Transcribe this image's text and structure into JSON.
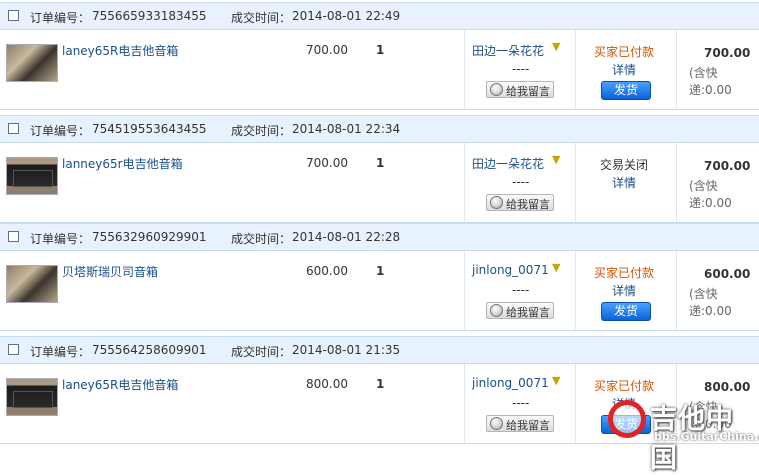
{
  "labels": {
    "order_no": "订单编号：",
    "deal_time": "成交时间：",
    "leave_message": "给我留言",
    "detail": "详情",
    "ship": "发货",
    "dashes": "----"
  },
  "orders": [
    {
      "order_no": "755665933183455",
      "deal_time": "2014-08-01 22:49",
      "product": "laney65R电吉他音箱",
      "price": "700.00",
      "qty": "1",
      "buyer": "田边一朵花花",
      "status": "买家已付款",
      "total": "700.00",
      "ship_fee": "(含快递:0.00"
    },
    {
      "order_no": "754519553643455",
      "deal_time": "2014-08-01 22:34",
      "product": "lanney65r电吉他音箱",
      "price": "700.00",
      "qty": "1",
      "buyer": "田边一朵花花",
      "status": "交易关闭",
      "total": "700.00",
      "ship_fee": "(含快递:0.00"
    },
    {
      "order_no": "755632960929901",
      "deal_time": "2014-08-01 22:28",
      "product": "贝塔斯瑞贝司音箱",
      "price": "600.00",
      "qty": "1",
      "buyer": "jinlong_0071",
      "status": "买家已付款",
      "total": "600.00",
      "ship_fee": "(含快递:0.00"
    },
    {
      "order_no": "755564258609901",
      "deal_time": "2014-08-01 21:35",
      "product": "laney65R电吉他音箱",
      "price": "800.00",
      "qty": "1",
      "buyer": "jinlong_0071",
      "status": "买家已付款",
      "total": "800.00",
      "ship_fee": "(含快递:0.00"
    }
  ],
  "watermark": {
    "title": "吉他中国",
    "subtitle": "bbs.GuitarChina.com"
  },
  "colors": {
    "header_bg": "#e8f2ff",
    "link": "#1b4f8c",
    "paid_status": "#d45500",
    "ship_button": "#0a63d8"
  }
}
